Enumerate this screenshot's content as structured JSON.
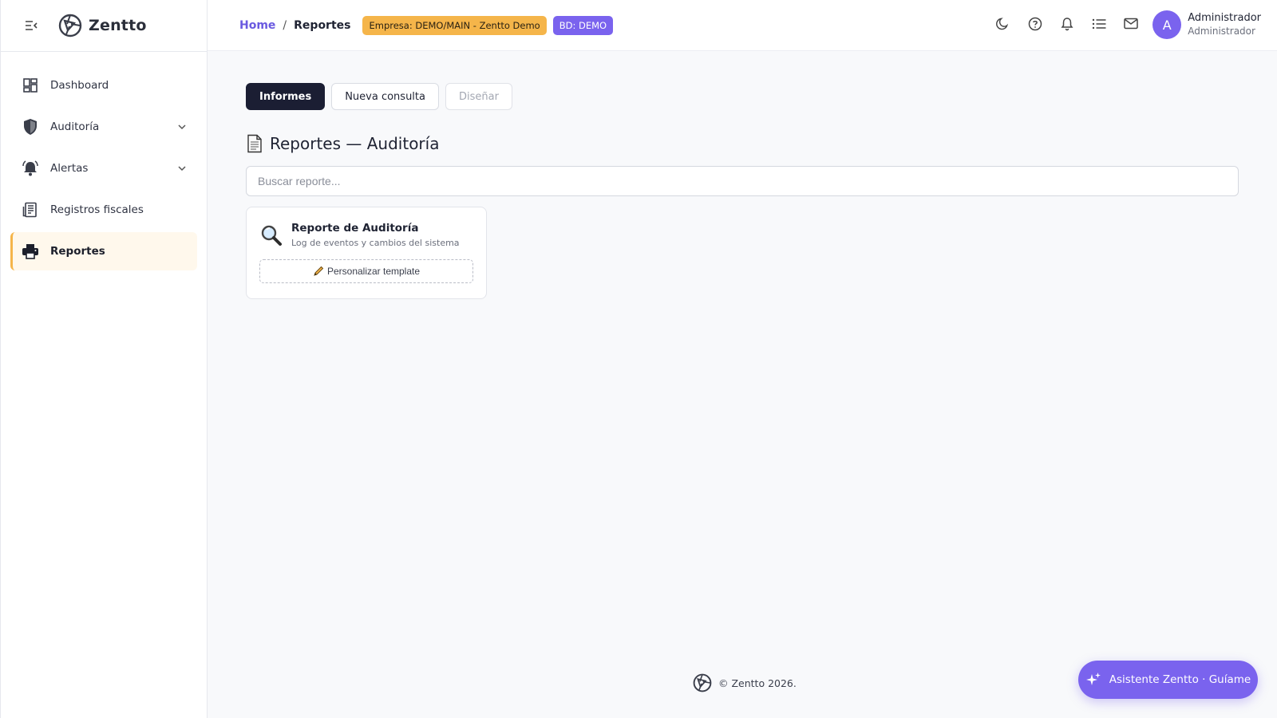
{
  "app": {
    "name": "Zentto"
  },
  "sidebar": {
    "items": [
      {
        "label": "Dashboard",
        "icon": "dashboard-icon",
        "expandable": false,
        "active": false
      },
      {
        "label": "Auditoría",
        "icon": "shield-icon",
        "expandable": true,
        "active": false
      },
      {
        "label": "Alertas",
        "icon": "alarm-bell-icon",
        "expandable": true,
        "active": false
      },
      {
        "label": "Registros fiscales",
        "icon": "receipt-icon",
        "expandable": false,
        "active": false
      },
      {
        "label": "Reportes",
        "icon": "printer-icon",
        "expandable": false,
        "active": true
      }
    ]
  },
  "header": {
    "breadcrumb": {
      "home": "Home",
      "separator": "/",
      "current": "Reportes"
    },
    "badge_empresa": "Empresa: DEMO/MAIN - Zentto Demo",
    "badge_bd": "BD: DEMO",
    "icons": [
      "moon-icon",
      "help-icon",
      "bell-icon",
      "list-icon",
      "mail-icon"
    ],
    "user": {
      "initial": "A",
      "name": "Administrador",
      "role": "Administrador"
    }
  },
  "main": {
    "tabs": [
      {
        "label": "Informes",
        "state": "active"
      },
      {
        "label": "Nueva consulta",
        "state": "normal"
      },
      {
        "label": "Diseñar",
        "state": "disabled"
      }
    ],
    "title": "Reportes — Auditoría",
    "search": {
      "placeholder": "Buscar reporte...",
      "value": ""
    },
    "cards": [
      {
        "title": "Reporte de Auditoría",
        "description": "Log de eventos y cambios del sistema",
        "button": "Personalizar template"
      }
    ]
  },
  "footer": {
    "text": "© Zentto 2026."
  },
  "assistant": {
    "label": "Asistente Zentto · Guíame"
  },
  "colors": {
    "accent": "#7a63ee",
    "warning": "#f5b54a",
    "dark": "#1b1e33"
  }
}
